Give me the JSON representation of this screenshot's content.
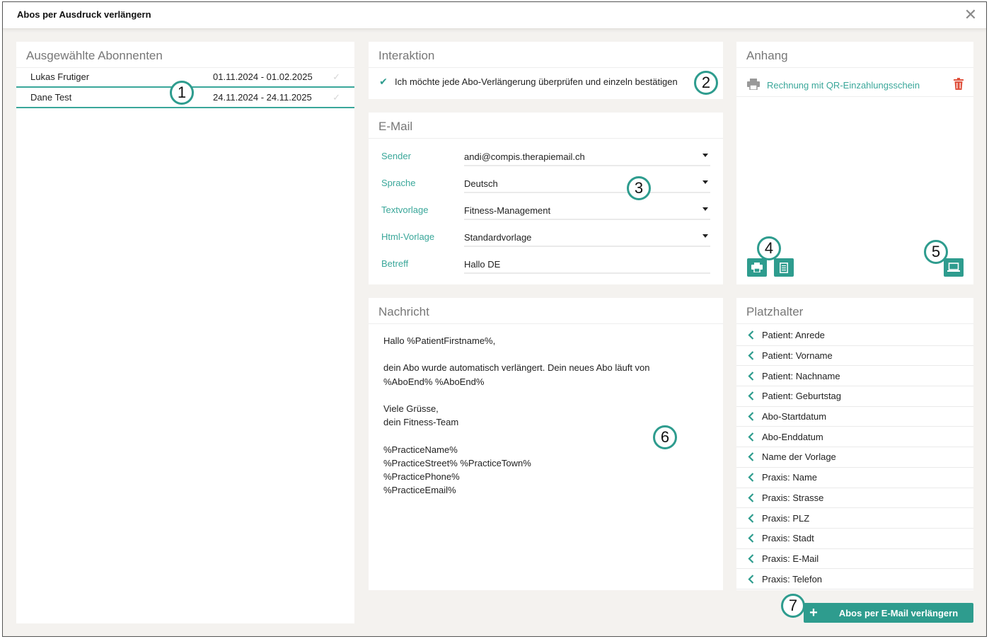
{
  "window": {
    "title": "Abos per Ausdruck verlängern"
  },
  "subscribers": {
    "title": "Ausgewählte Abonnenten",
    "rows": [
      {
        "name": "Lukas Frutiger",
        "dates": "01.11.2024 - 01.02.2025"
      },
      {
        "name": "Dane Test",
        "dates": "24.11.2024 - 24.11.2025"
      }
    ]
  },
  "interaction": {
    "title": "Interaktion",
    "checkbox_label": "Ich möchte jede Abo-Verlängerung überprüfen und einzeln bestätigen",
    "checked": true
  },
  "email": {
    "title": "E-Mail",
    "sender_label": "Sender",
    "sender_value": "andi@compis.therapiemail.ch",
    "language_label": "Sprache",
    "language_value": "Deutsch",
    "template_label": "Textvorlage",
    "template_value": "Fitness-Management",
    "html_label": "Html-Vorlage",
    "html_value": "Standardvorlage",
    "subject_label": "Betreff",
    "subject_value": "Hallo DE"
  },
  "attachment": {
    "title": "Anhang",
    "item_label": "Rechnung mit QR-Einzahlungsschein"
  },
  "message": {
    "title": "Nachricht",
    "body": "Hallo %PatientFirstname%,\n\ndein Abo wurde automatisch verlängert. Dein neues Abo läuft von\n%AboEnd% %AboEnd%\n\nViele Grüsse,\ndein Fitness-Team\n\n%PracticeName%\n%PracticeStreet% %PracticeTown%\n%PracticePhone%\n%PracticeEmail%"
  },
  "placeholders": {
    "title": "Platzhalter",
    "items": [
      "Patient: Anrede",
      "Patient: Vorname",
      "Patient: Nachname",
      "Patient: Geburtstag",
      "Abo-Startdatum",
      "Abo-Enddatum",
      "Name der Vorlage",
      "Praxis: Name",
      "Praxis: Strasse",
      "Praxis: PLZ",
      "Praxis: Stadt",
      "Praxis: E-Mail",
      "Praxis: Telefon"
    ]
  },
  "actions": {
    "primary_label": "Abos per E-Mail verlängern"
  },
  "badges": [
    "1",
    "2",
    "3",
    "4",
    "5",
    "6",
    "7"
  ],
  "colors": {
    "accent": "#2e9c8e",
    "danger": "#e0533f",
    "background": "#f4f2ef"
  }
}
